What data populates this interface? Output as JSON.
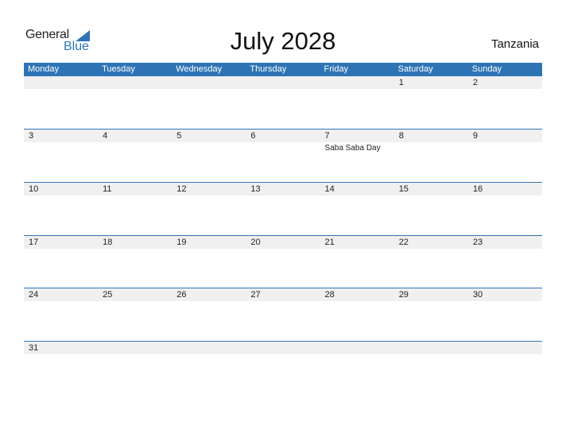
{
  "logo": {
    "general": "General",
    "blue": "Blue",
    "icon": "triangle-flag-icon"
  },
  "title": "July 2028",
  "country": "Tanzania",
  "weekdays": [
    "Monday",
    "Tuesday",
    "Wednesday",
    "Thursday",
    "Friday",
    "Saturday",
    "Sunday"
  ],
  "weeks": [
    [
      "",
      "",
      "",
      "",
      "",
      "1",
      "2"
    ],
    [
      "3",
      "4",
      "5",
      "6",
      "7",
      "8",
      "9"
    ],
    [
      "10",
      "11",
      "12",
      "13",
      "14",
      "15",
      "16"
    ],
    [
      "17",
      "18",
      "19",
      "20",
      "21",
      "22",
      "23"
    ],
    [
      "24",
      "25",
      "26",
      "27",
      "28",
      "29",
      "30"
    ],
    [
      "31",
      "",
      "",
      "",
      "",
      "",
      ""
    ]
  ],
  "events": [
    {
      "week": 1,
      "day": 4,
      "label": "Saba Saba Day"
    }
  ],
  "colors": {
    "accent": "#2e74b5",
    "band": "#f0f0f0"
  }
}
